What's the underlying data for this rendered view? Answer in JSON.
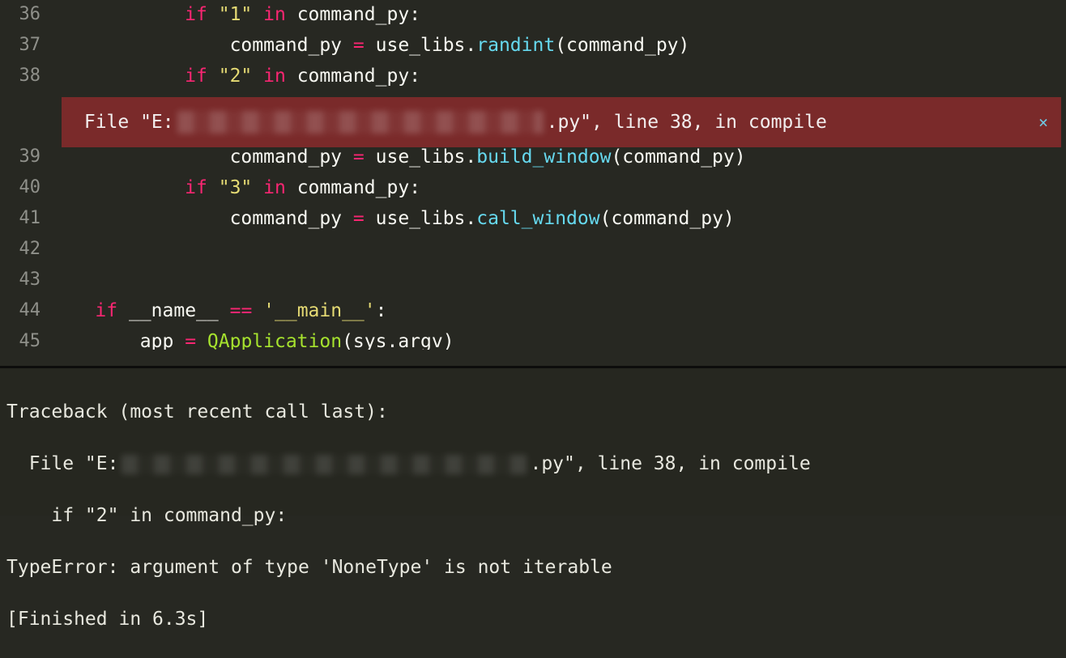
{
  "editor": {
    "line_numbers": [
      "36",
      "37",
      "38",
      "39",
      "40",
      "41",
      "42",
      "43",
      "44",
      "45"
    ],
    "lines": {
      "l36": {
        "indent": "            ",
        "kw": "if",
        "str": "\"1\"",
        "op": "in",
        "id": "command_py",
        "tail": ":"
      },
      "l37": {
        "indent": "                ",
        "id": "command_py",
        "eq": "=",
        "obj": "use_libs",
        "fn": "randint",
        "args": "(command_py)"
      },
      "l38": {
        "indent": "            ",
        "kw": "if",
        "str": "\"2\"",
        "op": "in",
        "id": "command_py",
        "tail": ":"
      },
      "l39": {
        "indent": "                ",
        "id": "command_py",
        "eq": "=",
        "obj": "use_libs",
        "fn": "build_window",
        "args": "(command_py)"
      },
      "l40": {
        "indent": "            ",
        "kw": "if",
        "str": "\"3\"",
        "op": "in",
        "id": "command_py",
        "tail": ":"
      },
      "l41": {
        "indent": "                ",
        "id": "command_py",
        "eq": "=",
        "obj": "use_libs",
        "fn": "call_window",
        "args": "(command_py)"
      },
      "l42": {},
      "l43": {},
      "l44": {
        "indent": "    ",
        "kw": "if",
        "id": "__name__",
        "op": "==",
        "str": "'__main__'",
        "tail": ":"
      },
      "l45": {
        "indent": "        ",
        "id": "app",
        "eq": "=",
        "cls": "QApplication",
        "args": "(sys.argv)"
      }
    }
  },
  "error_banner": {
    "prefix": " File \"E:",
    "suffix": ".py\", line 38, in compile",
    "close": "×"
  },
  "console": {
    "l1": "Traceback (most recent call last):",
    "l2_prefix": "  File \"E:",
    "l2_suffix": ".py\", line 38, in compile",
    "l3": "    if \"2\" in command_py:",
    "l4": "TypeError: argument of type 'NoneType' is not iterable",
    "l5": "[Finished in 6.3s]"
  }
}
